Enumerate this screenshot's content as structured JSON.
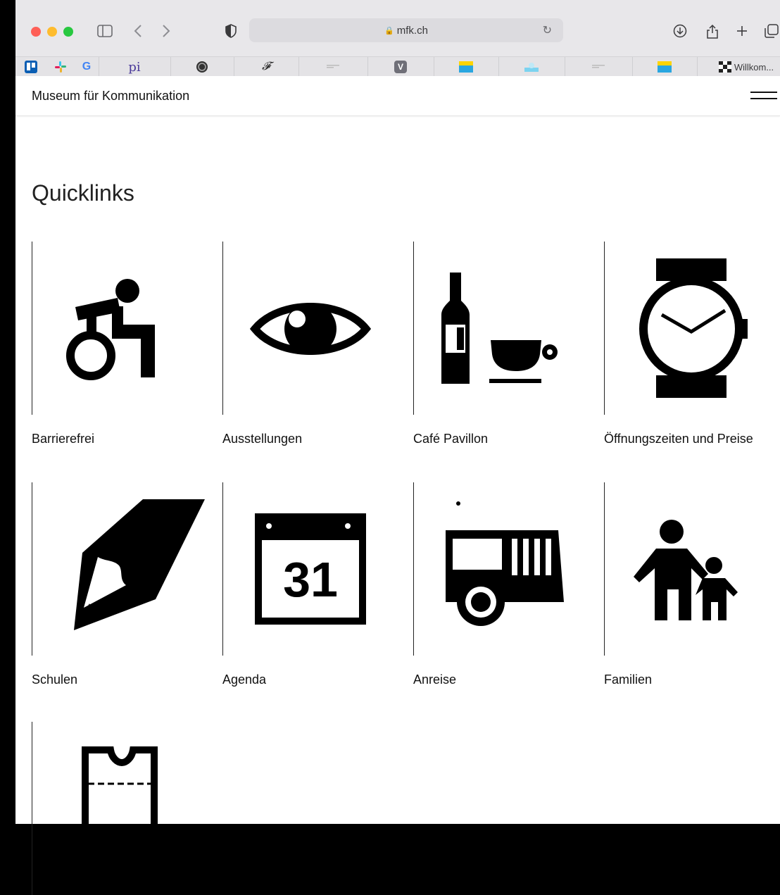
{
  "browser": {
    "url": "mfk.ch",
    "favorites": [
      {
        "icon": "trello-icon"
      },
      {
        "icon": "slack-icon"
      },
      {
        "icon": "google-icon",
        "label": "G"
      },
      {
        "icon": "pi-icon",
        "label": "pi"
      },
      {
        "icon": "globe-icon"
      },
      {
        "icon": "signature-icon"
      },
      {
        "icon": "doc-icon"
      },
      {
        "icon": "v-icon",
        "label": "V"
      },
      {
        "icon": "flag-icon"
      },
      {
        "icon": "cloud-icon"
      },
      {
        "icon": "doc-icon"
      },
      {
        "icon": "flag-icon"
      },
      {
        "icon": "checker-icon",
        "label": "Willkom..."
      }
    ]
  },
  "site": {
    "title": "Museum für Kommunikation"
  },
  "quicklinks": {
    "title": "Quicklinks",
    "items": [
      {
        "label": "Barrierefrei",
        "icon": "wheelchair-icon"
      },
      {
        "label": "Ausstellungen",
        "icon": "eye-icon"
      },
      {
        "label": "Café Pavillon",
        "icon": "bottle-cup-icon"
      },
      {
        "label": "Öffnungszeiten und Preise",
        "icon": "watch-icon"
      },
      {
        "label": "Schulen",
        "icon": "pencil-icon"
      },
      {
        "label": "Agenda",
        "icon": "calendar-icon",
        "glyph": "31"
      },
      {
        "label": "Anreise",
        "icon": "bus-icon"
      },
      {
        "label": "Familien",
        "icon": "family-icon"
      },
      {
        "label": "",
        "icon": "ticket-icon"
      }
    ]
  }
}
